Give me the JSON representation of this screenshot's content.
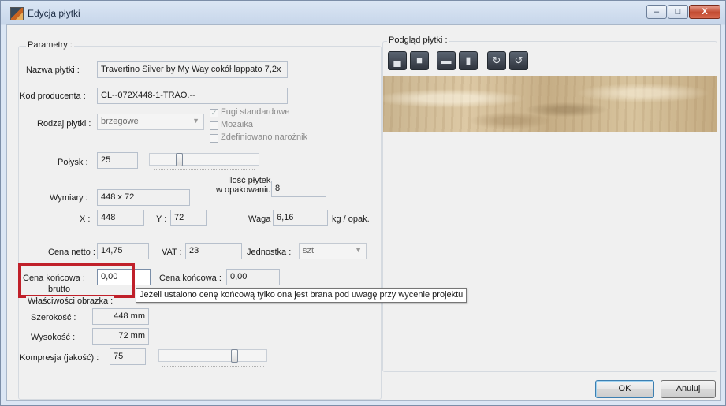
{
  "window": {
    "title": "Edycja płytki",
    "btn_min": "–",
    "btn_max": "□",
    "btn_close": "X"
  },
  "params": {
    "group_title": "Parametry :",
    "nazwa_label": "Nazwa płytki :",
    "nazwa_value": "Travertino Silver by My Way cokół lappato 7,2x",
    "kod_label": "Kod producenta :",
    "kod_value": "CL--072X448-1-TRAO.--",
    "rodzaj_label": "Rodzaj płytki :",
    "rodzaj_value": "brzegowe",
    "fugi_label": "Fugi standardowe",
    "mozaika_label": "Mozaika",
    "narożnik_label": "Zdefiniowano narożnik",
    "polysk_label": "Połysk :",
    "polysk_value": "25",
    "polysk_slider_level": 0.3,
    "ilosc_label_1": "Ilość płytek",
    "ilosc_label_2": "w opakowaniu",
    "ilosc_value": "8",
    "wymiary_label": "Wymiary :",
    "wymiary_value": "448 x 72",
    "x_label": "X :",
    "x_value": "448",
    "y_label": "Y :",
    "y_value": "72",
    "waga_label": "Waga :",
    "waga_value": "6,16",
    "waga_unit": "kg / opak.",
    "cena_netto_label": "Cena netto :",
    "cena_netto_value": "14,75",
    "vat_label": "VAT :",
    "vat_value": "23",
    "jednostka_label": "Jednostka :",
    "jednostka_value": "szt",
    "cena_konc_brutto_label_1": "Cena końcowa :",
    "cena_konc_brutto_label_2": "brutto",
    "cena_konc_brutto_value": "0,00",
    "cena_konc_label": "Cena końcowa :",
    "cena_konc_value": "0,00",
    "tooltip": "Jeżeli ustalono cenę końcową tylko ona jest brana pod uwagę przy wycenie projektu"
  },
  "image_props": {
    "group_title": "Właściwości obrazka :",
    "szerokosc_label": "Szerokość :",
    "szerokosc_value": "448 mm",
    "wysokosc_label": "Wysokość :",
    "wysokosc_value": "72 mm",
    "kompresja_label": "Kompresja (jakość) :",
    "kompresja_value": "75",
    "kompresja_slider_level": 0.75
  },
  "preview": {
    "group_title": "Podgląd płytki :",
    "tools": [
      "view-floor-icon",
      "view-tile-icon",
      "view-border-icon",
      "view-wall-icon",
      "rotate-right-icon",
      "rotate-left-icon"
    ]
  },
  "buttons": {
    "ok": "OK",
    "cancel": "Anuluj"
  },
  "colors": {
    "highlight": "#c0202a"
  }
}
